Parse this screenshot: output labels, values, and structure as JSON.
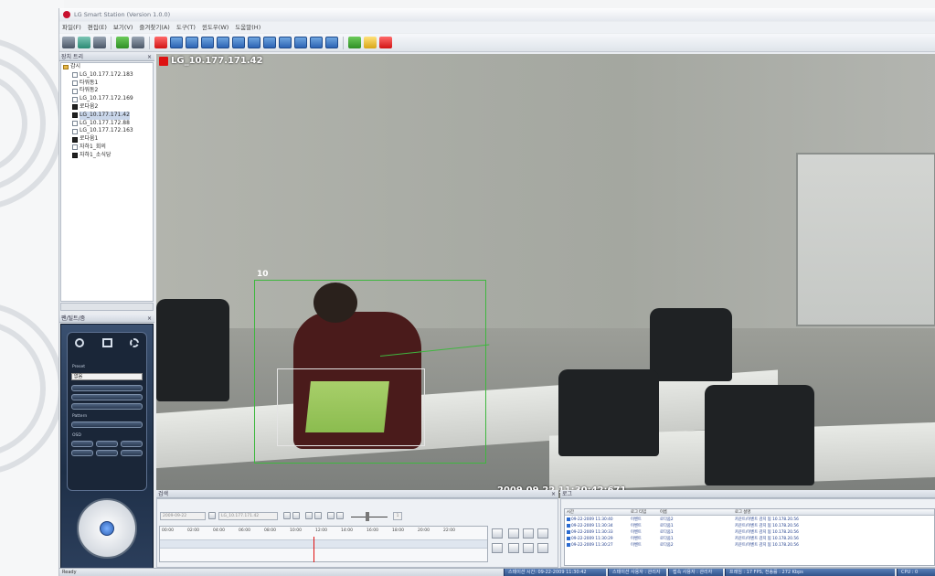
{
  "window": {
    "title": "LG Smart Station (Version 1.0.0)"
  },
  "menu": [
    "파일(F)",
    "편집(E)",
    "보기(V)",
    "즐겨찾기(A)",
    "도구(T)",
    "윈도우(W)",
    "도움말(H)"
  ],
  "toolbar": {
    "buttons": [
      "screen-layout",
      "search",
      "settings",
      "network",
      "print",
      "record",
      "monitor-1",
      "monitor-2",
      "monitor-3",
      "monitor-4",
      "monitor-5",
      "monitor-6",
      "monitor-7",
      "monitor-8",
      "monitor-9",
      "monitor-10",
      "monitor-11",
      "add",
      "chart",
      "close"
    ]
  },
  "tree_panel": {
    "title": "장치 트리",
    "close": "×",
    "items": [
      {
        "label": "감시",
        "level": 0,
        "type": "folder"
      },
      {
        "label": "LG_10.177.172.183",
        "level": 1,
        "type": "cam"
      },
      {
        "label": "타워동1",
        "level": 1,
        "type": "cam"
      },
      {
        "label": "타워동2",
        "level": 1,
        "type": "cam"
      },
      {
        "label": "LG_10.177.172.169",
        "level": 1,
        "type": "cam"
      },
      {
        "label": "로다움2",
        "level": 1,
        "type": "dark"
      },
      {
        "label": "LG_10.177.171.42",
        "level": 1,
        "type": "dark",
        "selected": true
      },
      {
        "label": "LG_10.177.172.88",
        "level": 1,
        "type": "cam"
      },
      {
        "label": "LG_10.177.172.163",
        "level": 1,
        "type": "cam"
      },
      {
        "label": "로다움1",
        "level": 1,
        "type": "dark"
      },
      {
        "label": "자하1_회의",
        "level": 1,
        "type": "cam"
      },
      {
        "label": "자하1_소식당",
        "level": 1,
        "type": "dark"
      }
    ]
  },
  "ptz_panel": {
    "title": "팬/틸트/줌",
    "close": "×",
    "preset_label": "Preset",
    "preset_value": "없음",
    "pattern_label": "Pattern",
    "osd_label": "OSD"
  },
  "video": {
    "camera_label": "LG_10.177.171.42",
    "roi_id": "10",
    "timestamp": "2009.09.22 11:30:42:671"
  },
  "search_panel": {
    "title": "검색",
    "close": "×",
    "date_value": "2009-09-22",
    "device_value": "LG_10.177.171.42",
    "speed_value": "1",
    "ticks": [
      "00:00",
      "02:00",
      "04:00",
      "06:00",
      "08:00",
      "10:00",
      "12:00",
      "14:00",
      "16:00",
      "18:00",
      "20:00",
      "22:00"
    ]
  },
  "log_panel": {
    "title": "로그",
    "close": "×",
    "columns": [
      "시간",
      "로그 타입",
      "이름",
      "로그 설명"
    ],
    "rows": [
      [
        "09-22-2009 11:30:40",
        "이벤트",
        "로다움2",
        "카운트/이벤트 감지 됨 10.178.20.56"
      ],
      [
        "09-22-2009 11:30:34",
        "이벤트",
        "로다움1",
        "카운트/이벤트 감지 됨 10.178.20.56"
      ],
      [
        "09-22-2009 11:30:33",
        "이벤트",
        "로다움1",
        "카운트/이벤트 감지 됨 10.178.20.56"
      ],
      [
        "09-22-2009 11:30:29",
        "이벤트",
        "로다움1",
        "카운트/이벤트 감지 됨 10.178.20.56"
      ],
      [
        "09-22-2009 11:30:27",
        "이벤트",
        "로다움2",
        "카운트/이벤트 감지 됨 10.178.20.56"
      ]
    ]
  },
  "statusbar": {
    "ready": "Ready",
    "start_time": "스테이션 시간: 09-22-2009 11:30:42",
    "user": "스테이션 사용자 : 관리자",
    "login_user": "접속 사용자 : 관리자",
    "stats": "프레임 : 17 FPS, 전송률 : 272 Kbps",
    "cpu": "CPU : 0"
  },
  "colors": {
    "roi_outer": "#3fb73f",
    "playhead": "#e01010",
    "accent": "#2d4f86",
    "record": "#d11111"
  }
}
